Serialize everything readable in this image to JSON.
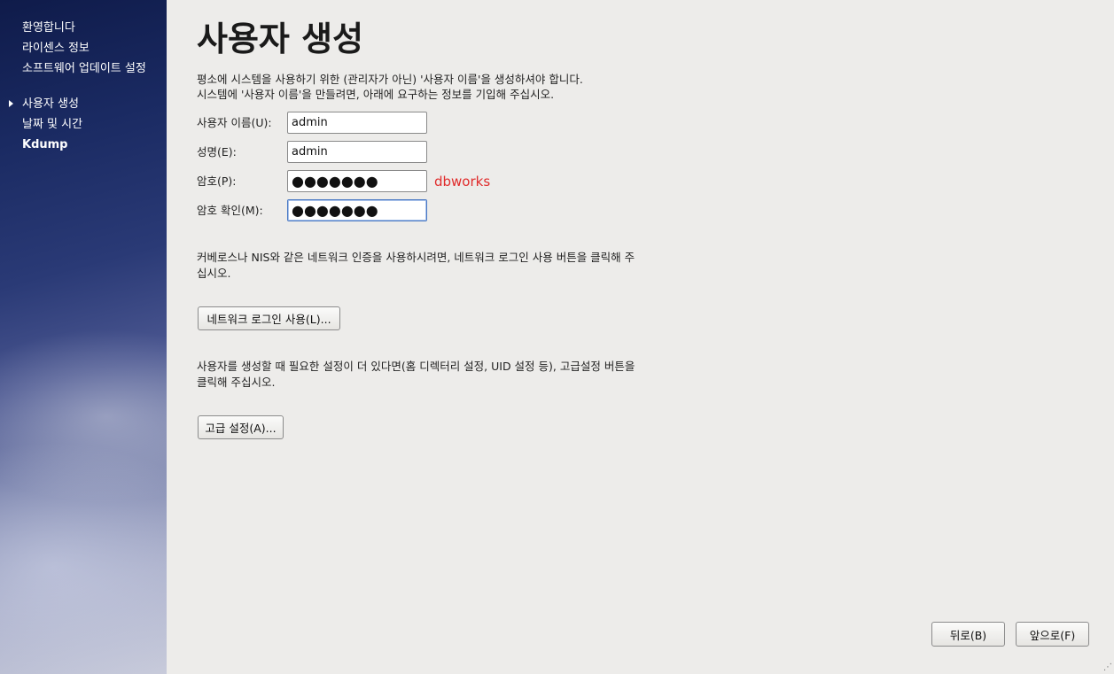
{
  "sidebar": {
    "items": [
      {
        "label": "환영합니다"
      },
      {
        "label": "라이센스 정보"
      },
      {
        "label": "소프트웨어 업데이트 설정"
      },
      {
        "label": "사용자 생성"
      },
      {
        "label": "날짜 및 시간"
      },
      {
        "label": "Kdump"
      }
    ]
  },
  "main": {
    "title": "사용자 생성",
    "intro_line1": "평소에 시스템을 사용하기 위한 (관리자가 아닌) '사용자 이름'을 생성하셔야 합니다.",
    "intro_line2": "시스템에 '사용자 이름'을 만들려면, 아래에 요구하는 정보를 기입해 주십시오.",
    "fields": {
      "username": {
        "label": "사용자 이름(U):",
        "value": "admin"
      },
      "fullname": {
        "label": "성명(E):",
        "value": "admin"
      },
      "password": {
        "label": "암호(P):",
        "value": "●●●●●●●"
      },
      "confirm": {
        "label": "암호 확인(M):",
        "value": "●●●●●●●"
      }
    },
    "password_annotation": "dbworks",
    "network_text": "커베로스나 NIS와 같은 네트워크 인증을 사용하시려면, 네트워크 로그인 사용 버튼을 클릭해 주십시오.",
    "network_button": "네트워크 로그인 사용(L)...",
    "advanced_text": "사용자를 생성할 때 필요한 설정이 더 있다면(홈 디렉터리 설정, UID 설정 등), 고급설정 버튼을 클릭해 주십시오.",
    "advanced_button": "고급 설정(A)..."
  },
  "footer": {
    "back_button": "뒤로(B)",
    "forward_button": "앞으로(F)"
  }
}
